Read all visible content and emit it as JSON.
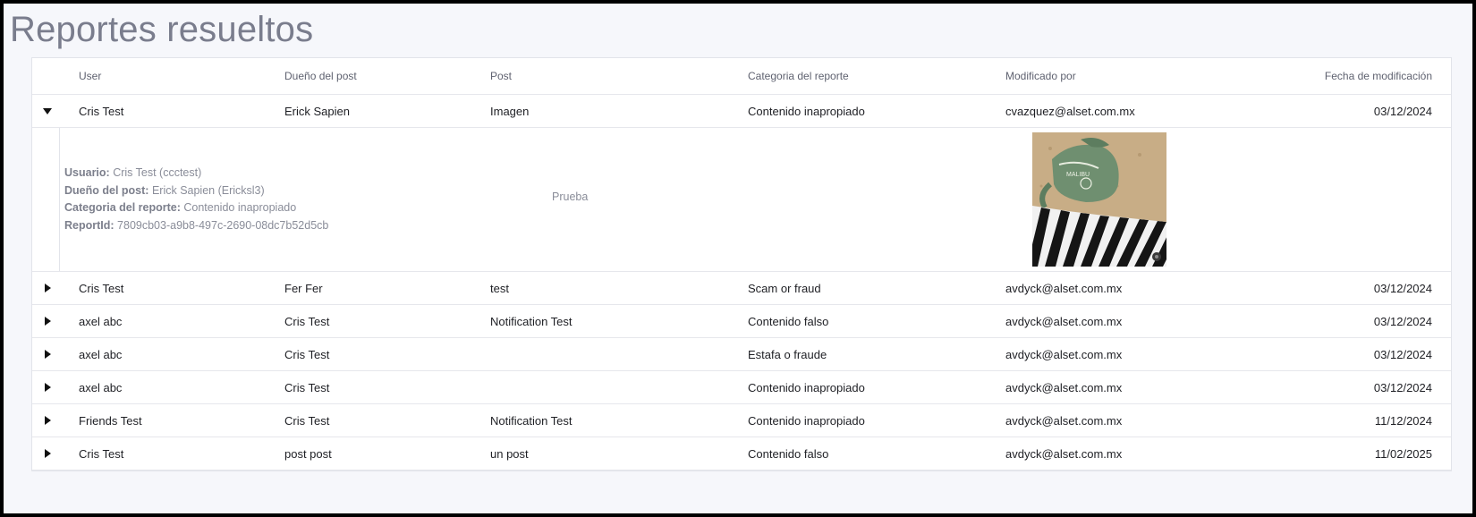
{
  "page": {
    "title": "Reportes resueltos"
  },
  "table": {
    "headers": {
      "user": "User",
      "owner": "Dueño del post",
      "post": "Post",
      "category": "Categoria del reporte",
      "modified_by": "Modificado por",
      "date": "Fecha de modificación"
    },
    "expanded_row": {
      "user": "Cris Test",
      "owner": "Erick Sapien",
      "post": "Imagen",
      "category": "Contenido inapropiado",
      "modified_by": "cvazquez@alset.com.mx",
      "date": "03/12/2024",
      "detail": {
        "usuario_label": "Usuario:",
        "usuario_value": "Cris Test (ccctest)",
        "owner_label": "Dueño del post:",
        "owner_value": "Erick Sapien (Ericksl3)",
        "category_label": "Categoria del reporte:",
        "category_value": "Contenido inapropiado",
        "report_label": "ReportId:",
        "report_value": "7809cb03-a9b8-497c-2690-08dc7b52d5cb",
        "post_text": "Prueba"
      }
    },
    "rows": [
      {
        "user": "Cris Test",
        "owner": "Fer Fer",
        "post": "test",
        "category": "Scam or fraud",
        "modified_by": "avdyck@alset.com.mx",
        "date": "03/12/2024"
      },
      {
        "user": "axel abc",
        "owner": "Cris Test",
        "post": "Notification Test",
        "category": "Contenido falso",
        "modified_by": "avdyck@alset.com.mx",
        "date": "03/12/2024"
      },
      {
        "user": "axel abc",
        "owner": "Cris Test",
        "post": "",
        "category": "Estafa o fraude",
        "modified_by": "avdyck@alset.com.mx",
        "date": "03/12/2024"
      },
      {
        "user": "axel abc",
        "owner": "Cris Test",
        "post": "",
        "category": "Contenido inapropiado",
        "modified_by": "avdyck@alset.com.mx",
        "date": "03/12/2024"
      },
      {
        "user": "Friends Test",
        "owner": "Cris Test",
        "post": "Notification Test",
        "category": "Contenido inapropiado",
        "modified_by": "avdyck@alset.com.mx",
        "date": "11/12/2024"
      },
      {
        "user": "Cris Test",
        "owner": "post post",
        "post": "un post",
        "category": "Contenido falso",
        "modified_by": "avdyck@alset.com.mx",
        "date": "11/02/2025"
      }
    ]
  }
}
